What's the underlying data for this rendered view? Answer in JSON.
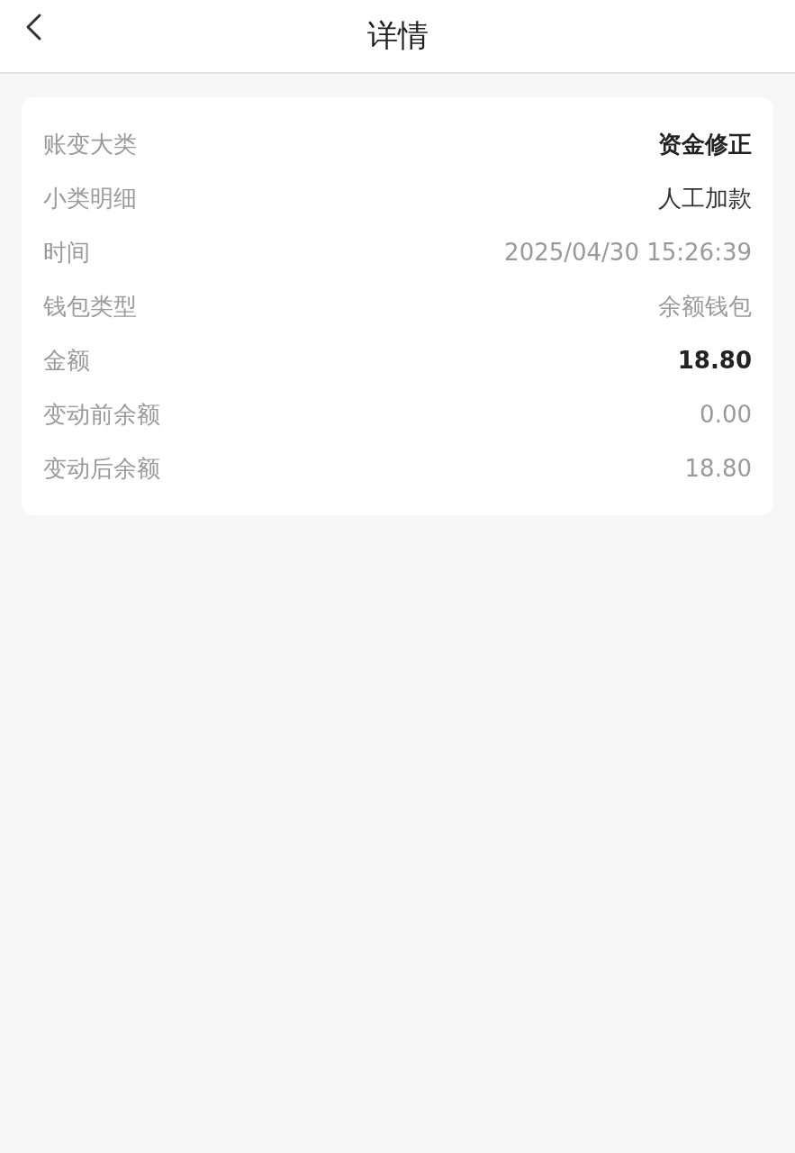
{
  "header": {
    "title": "详情"
  },
  "details": [
    {
      "label": "账变大类",
      "value": "资金修正",
      "kind": "bold"
    },
    {
      "label": "小类明细",
      "value": "人工加款",
      "kind": "dark"
    },
    {
      "label": "时间",
      "value": "2025/04/30 15:26:39",
      "kind": "muted"
    },
    {
      "label": "钱包类型",
      "value": "余额钱包",
      "kind": "muted"
    },
    {
      "label": "金额",
      "value": "18.80",
      "kind": "bold"
    },
    {
      "label": "变动前余额",
      "value": "0.00",
      "kind": "muted"
    },
    {
      "label": "变动后余额",
      "value": "18.80",
      "kind": "muted"
    }
  ]
}
